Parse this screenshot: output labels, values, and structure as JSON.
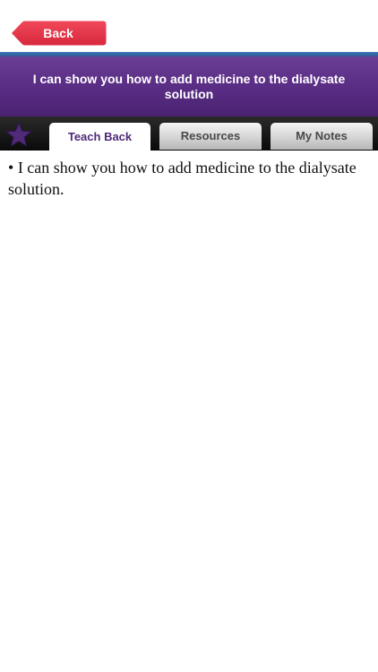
{
  "nav": {
    "back_label": "Back",
    "back_color": "#e8364a"
  },
  "header": {
    "title": "I can show you how to add medicine to the dialysate solution",
    "background": "#5c2f87"
  },
  "tabs": [
    {
      "label": "Teach Back",
      "selected": true
    },
    {
      "label": "Resources",
      "selected": false
    },
    {
      "label": "My Notes",
      "selected": false
    }
  ],
  "favorite": {
    "icon": "star-icon",
    "color": "#4e2a78"
  },
  "content": {
    "bullet": "•",
    "items": [
      "I can show you how to add medicine to the dialysate solution."
    ]
  }
}
